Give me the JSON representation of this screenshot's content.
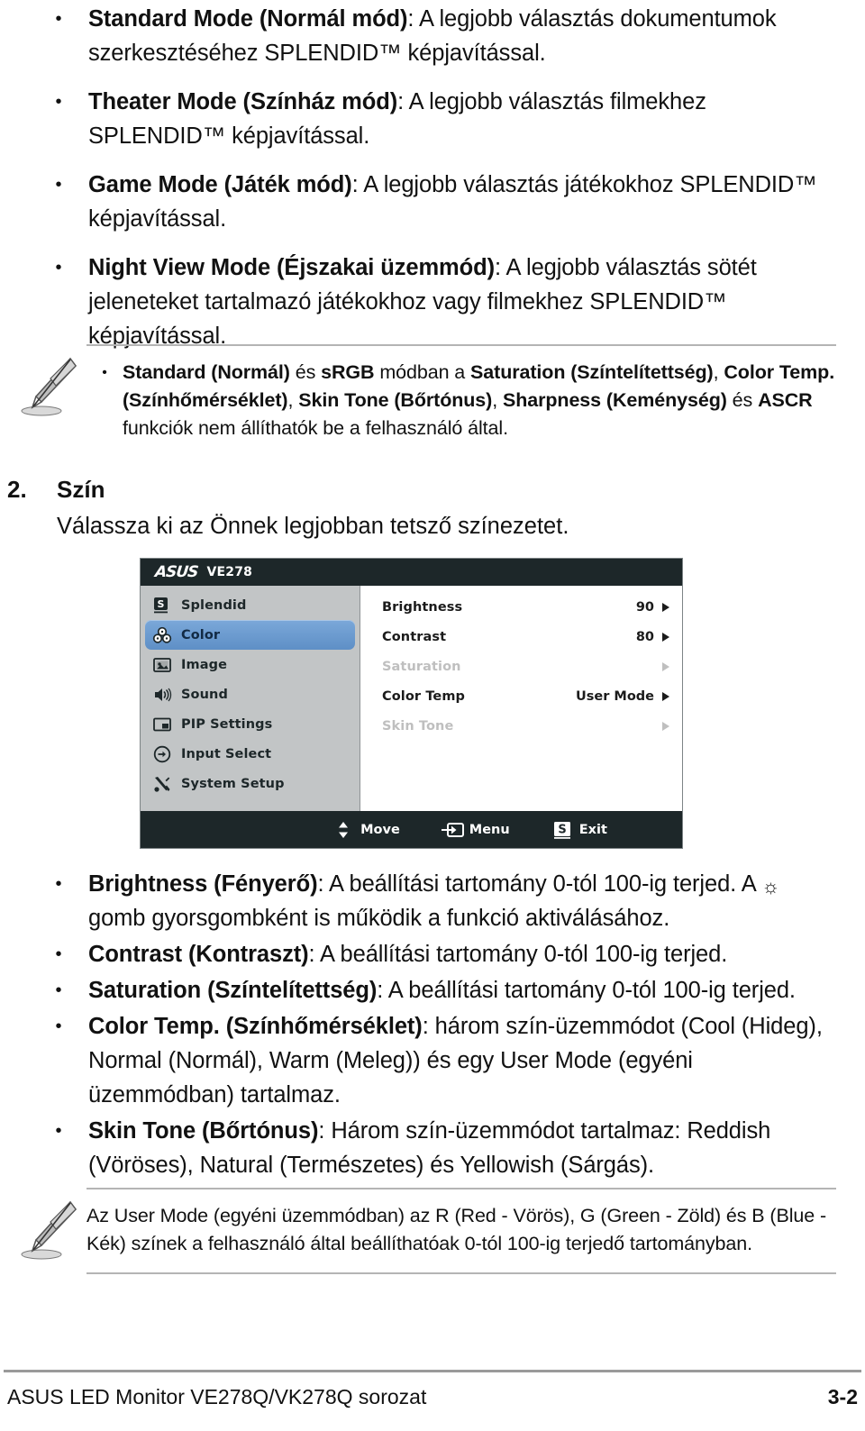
{
  "top_bullets": [
    {
      "bold": "Standard Mode (Normál mód)",
      "rest": ": A legjobb választás dokumentumok szerkesztéséhez SPLENDID™ képjavítással."
    },
    {
      "bold": "Theater Mode (Színház mód)",
      "rest": ": A legjobb választás filmekhez SPLENDID™ képjavítással."
    },
    {
      "bold": "Game Mode (Játék mód)",
      "rest": ": A legjobb választás játékokhoz SPLENDID™ képjavítással."
    },
    {
      "bold": "Night View Mode (Éjszakai üzemmód)",
      "rest": ": A legjobb választás sötét jeleneteket tartalmazó játékokhoz vagy filmekhez SPLENDID™ képjavítással."
    }
  ],
  "note_1": {
    "icon": "pencil-note-icon",
    "bullet_html": "<b>Standard (Normál)</b> és <b>sRGB</b> módban a <b>Saturation (Színtelítettség)</b>, <b>Color Temp. (Színhőmérséklet)</b>, <b>Skin Tone (Bőrtónus)</b>, <b>Sharpness (Keménység)</b> és <b>ASCR</b> funkciók nem állíthatók be a felhasználó által."
  },
  "section_2": {
    "number": "2.",
    "title": "Szín",
    "description": "Válassza ki az Önnek legjobban tetsző színezetet."
  },
  "osd": {
    "brand": "ASUS",
    "model": "VE278",
    "sidebar": [
      {
        "label": "Splendid",
        "icon": "splendid-s-icon",
        "selected": false
      },
      {
        "label": "Color",
        "icon": "color-palette-icon",
        "selected": true
      },
      {
        "label": "Image",
        "icon": "image-picture-icon",
        "selected": false
      },
      {
        "label": "Sound",
        "icon": "speaker-icon",
        "selected": false
      },
      {
        "label": "PIP Settings",
        "icon": "pip-window-icon",
        "selected": false
      },
      {
        "label": "Input Select",
        "icon": "input-arrow-icon",
        "selected": false
      },
      {
        "label": "System Setup",
        "icon": "tools-wrench-icon",
        "selected": false
      }
    ],
    "options": [
      {
        "name": "Brightness",
        "value": "90",
        "disabled": false
      },
      {
        "name": "Contrast",
        "value": "80",
        "disabled": false
      },
      {
        "name": "Saturation",
        "value": "",
        "disabled": true
      },
      {
        "name": "Color Temp",
        "value": "User Mode",
        "disabled": false
      },
      {
        "name": "Skin Tone",
        "value": "",
        "disabled": true
      }
    ],
    "footer": [
      {
        "label": "Move",
        "icon": "up-down-arrows-icon"
      },
      {
        "label": "Menu",
        "icon": "menu-enter-icon"
      },
      {
        "label": "Exit",
        "icon": "s-button-icon"
      }
    ],
    "colors": {
      "chrome": "#1d2729",
      "sidebar": "#c2c5c6",
      "panel": "#ffffff",
      "highlight": "#6b9bd2",
      "disabled_text": "#bfbfbf"
    }
  },
  "bottom_bullets": [
    {
      "bold": "Brightness (Fényerő)",
      "rest_before": ": A beállítási tartomány 0-tól 100-ig terjed. A ",
      "icon": "brightness-sun-icon",
      "rest_after": " gomb gyorsgombként is működik a funkció aktiválásához."
    },
    {
      "bold": "Contrast (Kontraszt)",
      "rest_before": ": A beállítási tartomány 0-tól 100-ig terjed.",
      "icon": "",
      "rest_after": ""
    },
    {
      "bold": "Saturation (Színtelítettség)",
      "rest_before": ": A beállítási tartomány 0-tól 100-ig terjed.",
      "icon": "",
      "rest_after": ""
    },
    {
      "bold": "Color Temp. (Színhőmérséklet)",
      "rest_before": ": három szín-üzemmódot (Cool (Hideg), Normal (Normál), Warm (Meleg)) és egy User Mode (egyéni üzemmódban) tartalmaz.",
      "icon": "",
      "rest_after": ""
    },
    {
      "bold": "Skin Tone (Bőrtónus)",
      "rest_before": ": Három szín-üzemmódot tartalmaz: Reddish (Vöröses), Natural (Természetes) és Yellowish (Sárgás).",
      "icon": "",
      "rest_after": ""
    }
  ],
  "note_2": {
    "icon": "pencil-note-icon",
    "text": "Az User Mode (egyéni üzemmódban) az R (Red - Vörös), G (Green - Zöld) és B (Blue - Kék) színek a felhasználó által beállíthatóak 0-tól 100-ig terjedő tartományban."
  },
  "page_footer": {
    "left": "ASUS LED Monitor VE278Q/VK278Q sorozat",
    "right": "3-2"
  }
}
